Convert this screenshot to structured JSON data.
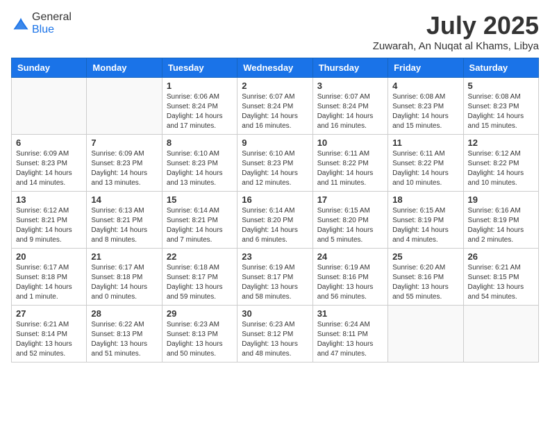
{
  "logo": {
    "general": "General",
    "blue": "Blue"
  },
  "header": {
    "month": "July 2025",
    "location": "Zuwarah, An Nuqat al Khams, Libya"
  },
  "weekdays": [
    "Sunday",
    "Monday",
    "Tuesday",
    "Wednesday",
    "Thursday",
    "Friday",
    "Saturday"
  ],
  "weeks": [
    [
      {
        "day": "",
        "info": ""
      },
      {
        "day": "",
        "info": ""
      },
      {
        "day": "1",
        "info": "Sunrise: 6:06 AM\nSunset: 8:24 PM\nDaylight: 14 hours and 17 minutes."
      },
      {
        "day": "2",
        "info": "Sunrise: 6:07 AM\nSunset: 8:24 PM\nDaylight: 14 hours and 16 minutes."
      },
      {
        "day": "3",
        "info": "Sunrise: 6:07 AM\nSunset: 8:24 PM\nDaylight: 14 hours and 16 minutes."
      },
      {
        "day": "4",
        "info": "Sunrise: 6:08 AM\nSunset: 8:23 PM\nDaylight: 14 hours and 15 minutes."
      },
      {
        "day": "5",
        "info": "Sunrise: 6:08 AM\nSunset: 8:23 PM\nDaylight: 14 hours and 15 minutes."
      }
    ],
    [
      {
        "day": "6",
        "info": "Sunrise: 6:09 AM\nSunset: 8:23 PM\nDaylight: 14 hours and 14 minutes."
      },
      {
        "day": "7",
        "info": "Sunrise: 6:09 AM\nSunset: 8:23 PM\nDaylight: 14 hours and 13 minutes."
      },
      {
        "day": "8",
        "info": "Sunrise: 6:10 AM\nSunset: 8:23 PM\nDaylight: 14 hours and 13 minutes."
      },
      {
        "day": "9",
        "info": "Sunrise: 6:10 AM\nSunset: 8:23 PM\nDaylight: 14 hours and 12 minutes."
      },
      {
        "day": "10",
        "info": "Sunrise: 6:11 AM\nSunset: 8:22 PM\nDaylight: 14 hours and 11 minutes."
      },
      {
        "day": "11",
        "info": "Sunrise: 6:11 AM\nSunset: 8:22 PM\nDaylight: 14 hours and 10 minutes."
      },
      {
        "day": "12",
        "info": "Sunrise: 6:12 AM\nSunset: 8:22 PM\nDaylight: 14 hours and 10 minutes."
      }
    ],
    [
      {
        "day": "13",
        "info": "Sunrise: 6:12 AM\nSunset: 8:21 PM\nDaylight: 14 hours and 9 minutes."
      },
      {
        "day": "14",
        "info": "Sunrise: 6:13 AM\nSunset: 8:21 PM\nDaylight: 14 hours and 8 minutes."
      },
      {
        "day": "15",
        "info": "Sunrise: 6:14 AM\nSunset: 8:21 PM\nDaylight: 14 hours and 7 minutes."
      },
      {
        "day": "16",
        "info": "Sunrise: 6:14 AM\nSunset: 8:20 PM\nDaylight: 14 hours and 6 minutes."
      },
      {
        "day": "17",
        "info": "Sunrise: 6:15 AM\nSunset: 8:20 PM\nDaylight: 14 hours and 5 minutes."
      },
      {
        "day": "18",
        "info": "Sunrise: 6:15 AM\nSunset: 8:19 PM\nDaylight: 14 hours and 4 minutes."
      },
      {
        "day": "19",
        "info": "Sunrise: 6:16 AM\nSunset: 8:19 PM\nDaylight: 14 hours and 2 minutes."
      }
    ],
    [
      {
        "day": "20",
        "info": "Sunrise: 6:17 AM\nSunset: 8:18 PM\nDaylight: 14 hours and 1 minute."
      },
      {
        "day": "21",
        "info": "Sunrise: 6:17 AM\nSunset: 8:18 PM\nDaylight: 14 hours and 0 minutes."
      },
      {
        "day": "22",
        "info": "Sunrise: 6:18 AM\nSunset: 8:17 PM\nDaylight: 13 hours and 59 minutes."
      },
      {
        "day": "23",
        "info": "Sunrise: 6:19 AM\nSunset: 8:17 PM\nDaylight: 13 hours and 58 minutes."
      },
      {
        "day": "24",
        "info": "Sunrise: 6:19 AM\nSunset: 8:16 PM\nDaylight: 13 hours and 56 minutes."
      },
      {
        "day": "25",
        "info": "Sunrise: 6:20 AM\nSunset: 8:16 PM\nDaylight: 13 hours and 55 minutes."
      },
      {
        "day": "26",
        "info": "Sunrise: 6:21 AM\nSunset: 8:15 PM\nDaylight: 13 hours and 54 minutes."
      }
    ],
    [
      {
        "day": "27",
        "info": "Sunrise: 6:21 AM\nSunset: 8:14 PM\nDaylight: 13 hours and 52 minutes."
      },
      {
        "day": "28",
        "info": "Sunrise: 6:22 AM\nSunset: 8:13 PM\nDaylight: 13 hours and 51 minutes."
      },
      {
        "day": "29",
        "info": "Sunrise: 6:23 AM\nSunset: 8:13 PM\nDaylight: 13 hours and 50 minutes."
      },
      {
        "day": "30",
        "info": "Sunrise: 6:23 AM\nSunset: 8:12 PM\nDaylight: 13 hours and 48 minutes."
      },
      {
        "day": "31",
        "info": "Sunrise: 6:24 AM\nSunset: 8:11 PM\nDaylight: 13 hours and 47 minutes."
      },
      {
        "day": "",
        "info": ""
      },
      {
        "day": "",
        "info": ""
      }
    ]
  ]
}
